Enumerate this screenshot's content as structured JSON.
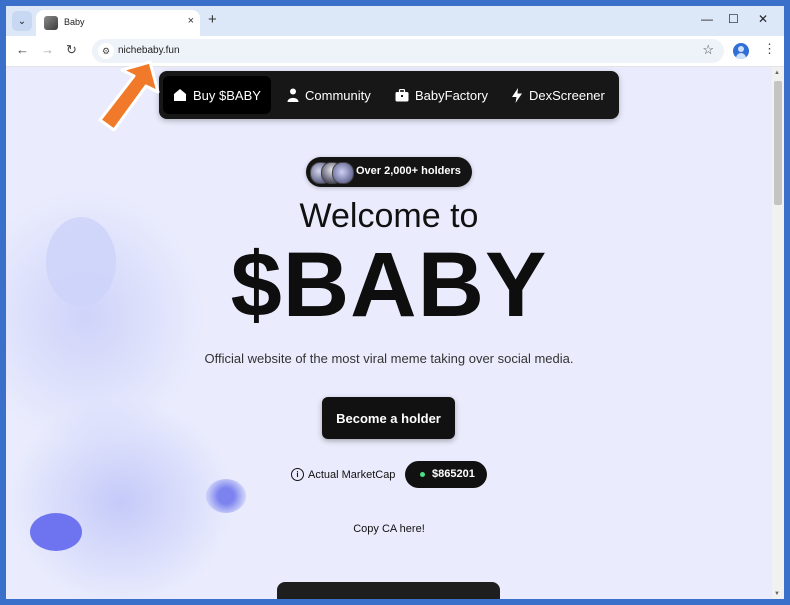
{
  "browser": {
    "tab_title": "Baby",
    "tab_close": "×",
    "new_tab": "+",
    "url": "nichebaby.fun",
    "window_controls": {
      "minimize": "—",
      "maximize": "☐",
      "close": "✕"
    }
  },
  "nav": {
    "items": [
      {
        "label": "Buy $BABY",
        "icon": "home-icon",
        "active": true
      },
      {
        "label": "Community",
        "icon": "user-icon"
      },
      {
        "label": "BabyFactory",
        "icon": "briefcase-icon"
      },
      {
        "label": "DexScreener",
        "icon": "bolt-icon"
      }
    ]
  },
  "hero": {
    "holders_badge": "Over 2,000+ holders",
    "welcome": "Welcome to",
    "ticker": "$BABY",
    "tagline": "Official website of the most viral meme taking over social media.",
    "cta_label": "Become a holder",
    "marketcap_label": "Actual MarketCap",
    "marketcap_value": "$865201",
    "copy_ca": "Copy CA here!"
  },
  "colors": {
    "page_bg": "#eaecfd",
    "nav_bg": "#171717",
    "accent_annotation": "#f07a2a",
    "status_dot": "#4ade80"
  }
}
